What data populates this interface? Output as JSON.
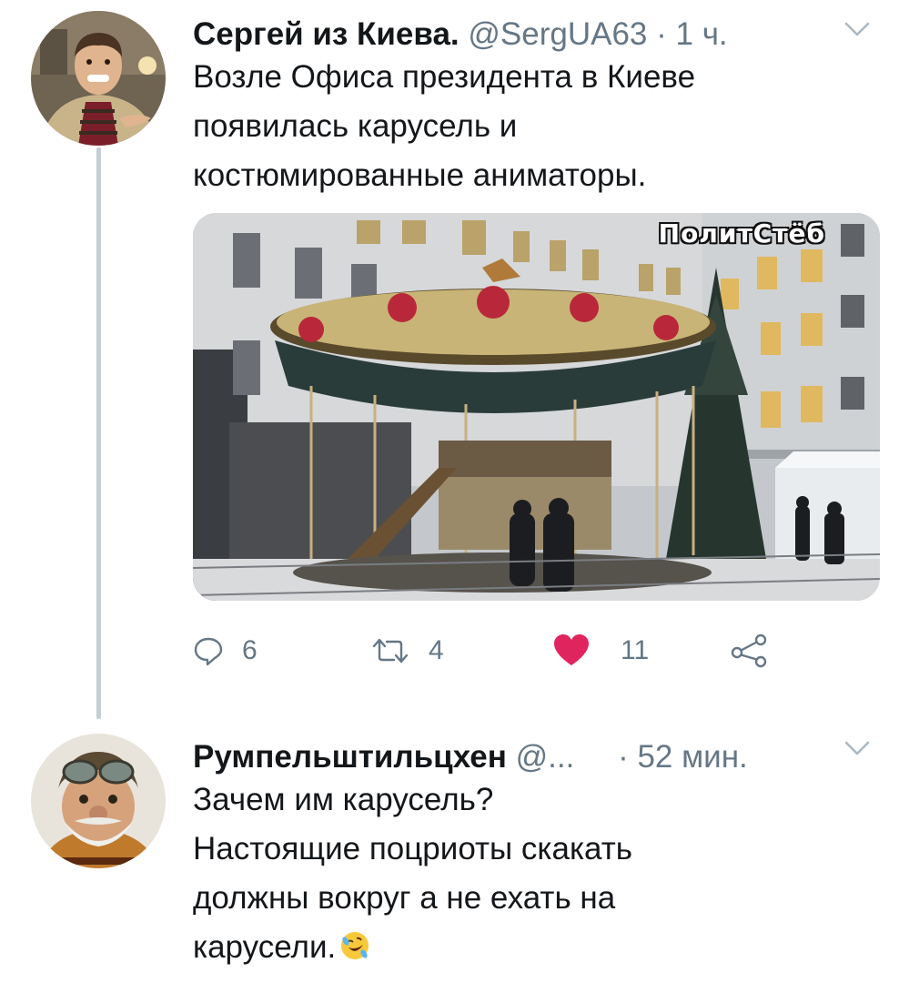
{
  "tweets": [
    {
      "author_name": "Сергей из Киева.",
      "handle": "@SergUA63",
      "time": "· 1 ч.",
      "text_lines": [
        "Возле Офиса президента в Киеве",
        "появилась карусель и",
        "костюмированные аниматоры."
      ],
      "media": {
        "watermark": "ПолитСтёб"
      },
      "actions": {
        "reply_count": "6",
        "retweet_count": "4",
        "like_count": "11"
      },
      "icons": [
        "reply-icon",
        "retweet-icon",
        "heart-icon",
        "share-icon",
        "chevron-down-icon"
      ],
      "colors": {
        "like": "#e0245e",
        "secondary": "#657786"
      }
    },
    {
      "author_name": "Румпельштильцхен",
      "handle": "@...",
      "time": "· 52 мин.",
      "text_lines": [
        "Зачем им карусель?",
        "Настоящие поцриоты скакать",
        "должны вокруг а не ехать на",
        "карусели."
      ],
      "emoji": "rolling-on-floor-laughing-emoji",
      "icons": [
        "chevron-down-icon"
      ]
    }
  ]
}
